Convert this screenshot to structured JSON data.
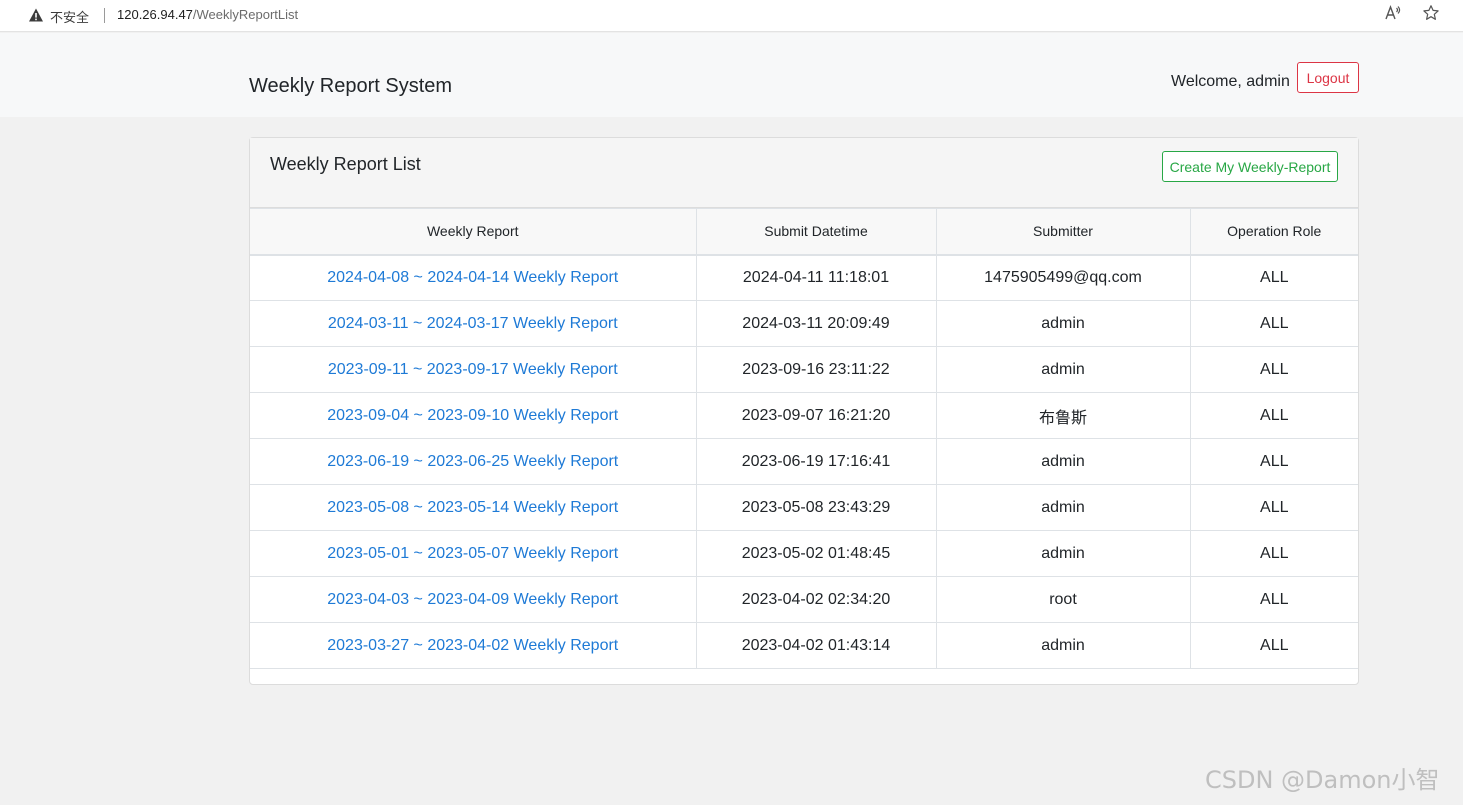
{
  "browser": {
    "insecure_label": "不安全",
    "url_host": "120.26.94.47",
    "url_path": "/WeeklyReportList"
  },
  "header": {
    "brand": "Weekly Report System",
    "welcome": "Welcome, admin",
    "logout_label": "Logout"
  },
  "card": {
    "title": "Weekly Report List",
    "create_label": "Create My Weekly-Report"
  },
  "table": {
    "columns": [
      "Weekly Report",
      "Submit Datetime",
      "Submitter",
      "Operation Role"
    ],
    "rows": [
      {
        "report": "2024-04-08 ~ 2024-04-14 Weekly Report",
        "datetime": "2024-04-11 11:18:01",
        "submitter": "1475905499@qq.com",
        "role": "ALL"
      },
      {
        "report": "2024-03-11 ~ 2024-03-17 Weekly Report",
        "datetime": "2024-03-11 20:09:49",
        "submitter": "admin",
        "role": "ALL"
      },
      {
        "report": "2023-09-11 ~ 2023-09-17 Weekly Report",
        "datetime": "2023-09-16 23:11:22",
        "submitter": "admin",
        "role": "ALL"
      },
      {
        "report": "2023-09-04 ~ 2023-09-10 Weekly Report",
        "datetime": "2023-09-07 16:21:20",
        "submitter": "布鲁斯",
        "role": "ALL"
      },
      {
        "report": "2023-06-19 ~ 2023-06-25 Weekly Report",
        "datetime": "2023-06-19 17:16:41",
        "submitter": "admin",
        "role": "ALL"
      },
      {
        "report": "2023-05-08 ~ 2023-05-14 Weekly Report",
        "datetime": "2023-05-08 23:43:29",
        "submitter": "admin",
        "role": "ALL"
      },
      {
        "report": "2023-05-01 ~ 2023-05-07 Weekly Report",
        "datetime": "2023-05-02 01:48:45",
        "submitter": "admin",
        "role": "ALL"
      },
      {
        "report": "2023-04-03 ~ 2023-04-09 Weekly Report",
        "datetime": "2023-04-02 02:34:20",
        "submitter": "root",
        "role": "ALL"
      },
      {
        "report": "2023-03-27 ~ 2023-04-02 Weekly Report",
        "datetime": "2023-04-02 01:43:14",
        "submitter": "admin",
        "role": "ALL"
      }
    ]
  },
  "watermark": "CSDN @Damon小智",
  "colors": {
    "link": "#1e7ad6",
    "logout": "#dc3545",
    "create": "#28a745"
  },
  "icons": {
    "warning": "warning-triangle-icon",
    "read_aloud": "read-aloud-icon",
    "favorite": "star-icon"
  }
}
